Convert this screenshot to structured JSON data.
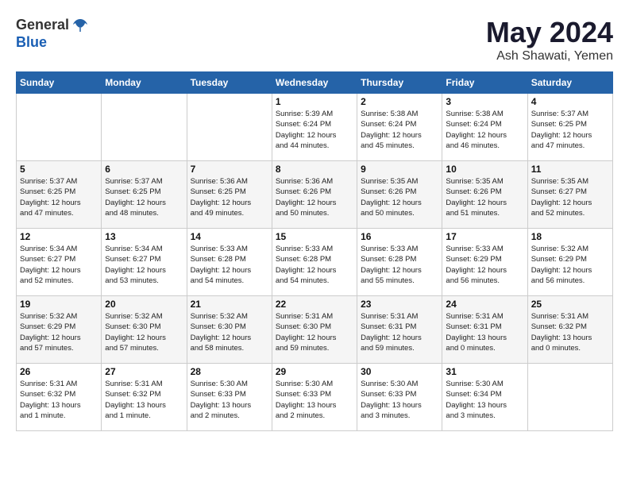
{
  "header": {
    "logo_general": "General",
    "logo_blue": "Blue",
    "title": "May 2024",
    "location": "Ash Shawati, Yemen"
  },
  "weekdays": [
    "Sunday",
    "Monday",
    "Tuesday",
    "Wednesday",
    "Thursday",
    "Friday",
    "Saturday"
  ],
  "weeks": [
    [
      {
        "day": "",
        "info": ""
      },
      {
        "day": "",
        "info": ""
      },
      {
        "day": "",
        "info": ""
      },
      {
        "day": "1",
        "info": "Sunrise: 5:39 AM\nSunset: 6:24 PM\nDaylight: 12 hours\nand 44 minutes."
      },
      {
        "day": "2",
        "info": "Sunrise: 5:38 AM\nSunset: 6:24 PM\nDaylight: 12 hours\nand 45 minutes."
      },
      {
        "day": "3",
        "info": "Sunrise: 5:38 AM\nSunset: 6:24 PM\nDaylight: 12 hours\nand 46 minutes."
      },
      {
        "day": "4",
        "info": "Sunrise: 5:37 AM\nSunset: 6:25 PM\nDaylight: 12 hours\nand 47 minutes."
      }
    ],
    [
      {
        "day": "5",
        "info": "Sunrise: 5:37 AM\nSunset: 6:25 PM\nDaylight: 12 hours\nand 47 minutes."
      },
      {
        "day": "6",
        "info": "Sunrise: 5:37 AM\nSunset: 6:25 PM\nDaylight: 12 hours\nand 48 minutes."
      },
      {
        "day": "7",
        "info": "Sunrise: 5:36 AM\nSunset: 6:25 PM\nDaylight: 12 hours\nand 49 minutes."
      },
      {
        "day": "8",
        "info": "Sunrise: 5:36 AM\nSunset: 6:26 PM\nDaylight: 12 hours\nand 50 minutes."
      },
      {
        "day": "9",
        "info": "Sunrise: 5:35 AM\nSunset: 6:26 PM\nDaylight: 12 hours\nand 50 minutes."
      },
      {
        "day": "10",
        "info": "Sunrise: 5:35 AM\nSunset: 6:26 PM\nDaylight: 12 hours\nand 51 minutes."
      },
      {
        "day": "11",
        "info": "Sunrise: 5:35 AM\nSunset: 6:27 PM\nDaylight: 12 hours\nand 52 minutes."
      }
    ],
    [
      {
        "day": "12",
        "info": "Sunrise: 5:34 AM\nSunset: 6:27 PM\nDaylight: 12 hours\nand 52 minutes."
      },
      {
        "day": "13",
        "info": "Sunrise: 5:34 AM\nSunset: 6:27 PM\nDaylight: 12 hours\nand 53 minutes."
      },
      {
        "day": "14",
        "info": "Sunrise: 5:33 AM\nSunset: 6:28 PM\nDaylight: 12 hours\nand 54 minutes."
      },
      {
        "day": "15",
        "info": "Sunrise: 5:33 AM\nSunset: 6:28 PM\nDaylight: 12 hours\nand 54 minutes."
      },
      {
        "day": "16",
        "info": "Sunrise: 5:33 AM\nSunset: 6:28 PM\nDaylight: 12 hours\nand 55 minutes."
      },
      {
        "day": "17",
        "info": "Sunrise: 5:33 AM\nSunset: 6:29 PM\nDaylight: 12 hours\nand 56 minutes."
      },
      {
        "day": "18",
        "info": "Sunrise: 5:32 AM\nSunset: 6:29 PM\nDaylight: 12 hours\nand 56 minutes."
      }
    ],
    [
      {
        "day": "19",
        "info": "Sunrise: 5:32 AM\nSunset: 6:29 PM\nDaylight: 12 hours\nand 57 minutes."
      },
      {
        "day": "20",
        "info": "Sunrise: 5:32 AM\nSunset: 6:30 PM\nDaylight: 12 hours\nand 57 minutes."
      },
      {
        "day": "21",
        "info": "Sunrise: 5:32 AM\nSunset: 6:30 PM\nDaylight: 12 hours\nand 58 minutes."
      },
      {
        "day": "22",
        "info": "Sunrise: 5:31 AM\nSunset: 6:30 PM\nDaylight: 12 hours\nand 59 minutes."
      },
      {
        "day": "23",
        "info": "Sunrise: 5:31 AM\nSunset: 6:31 PM\nDaylight: 12 hours\nand 59 minutes."
      },
      {
        "day": "24",
        "info": "Sunrise: 5:31 AM\nSunset: 6:31 PM\nDaylight: 13 hours\nand 0 minutes."
      },
      {
        "day": "25",
        "info": "Sunrise: 5:31 AM\nSunset: 6:32 PM\nDaylight: 13 hours\nand 0 minutes."
      }
    ],
    [
      {
        "day": "26",
        "info": "Sunrise: 5:31 AM\nSunset: 6:32 PM\nDaylight: 13 hours\nand 1 minute."
      },
      {
        "day": "27",
        "info": "Sunrise: 5:31 AM\nSunset: 6:32 PM\nDaylight: 13 hours\nand 1 minute."
      },
      {
        "day": "28",
        "info": "Sunrise: 5:30 AM\nSunset: 6:33 PM\nDaylight: 13 hours\nand 2 minutes."
      },
      {
        "day": "29",
        "info": "Sunrise: 5:30 AM\nSunset: 6:33 PM\nDaylight: 13 hours\nand 2 minutes."
      },
      {
        "day": "30",
        "info": "Sunrise: 5:30 AM\nSunset: 6:33 PM\nDaylight: 13 hours\nand 3 minutes."
      },
      {
        "day": "31",
        "info": "Sunrise: 5:30 AM\nSunset: 6:34 PM\nDaylight: 13 hours\nand 3 minutes."
      },
      {
        "day": "",
        "info": ""
      }
    ]
  ]
}
